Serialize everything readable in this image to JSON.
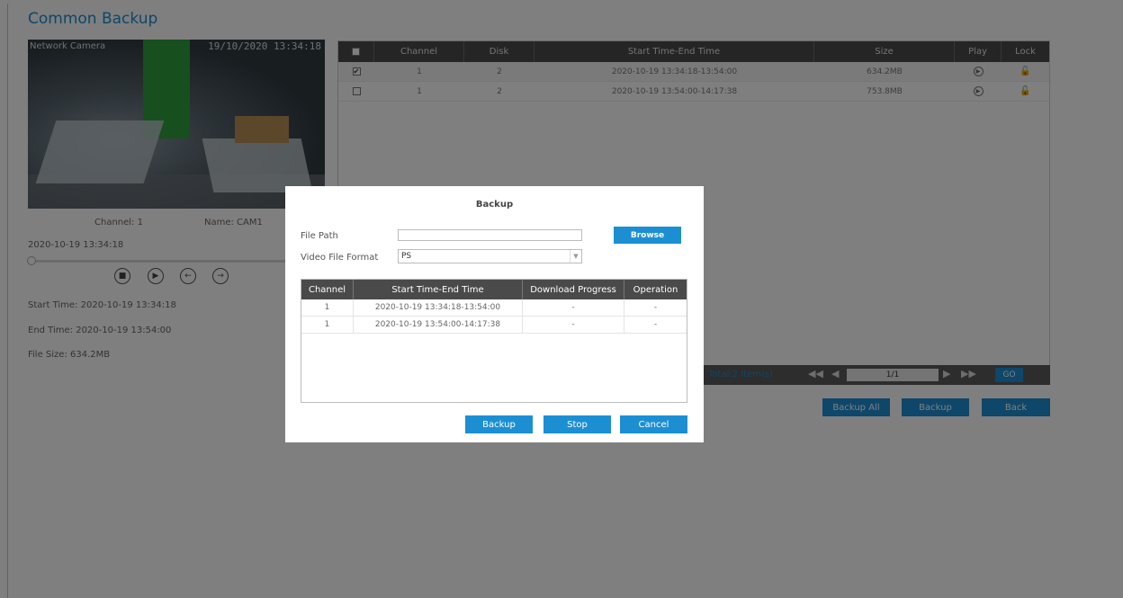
{
  "page": {
    "title": "Common Backup"
  },
  "preview": {
    "overlay_label": "Network Camera",
    "overlay_time": "19/10/2020 13:34:18",
    "channel": "Channel: 1",
    "name": "Name: CAM1",
    "current_time": "2020-10-19 13:34:18",
    "controls": {
      "stop_icon": "stop-icon",
      "play_icon": "play-icon",
      "back_icon": "step-back-icon",
      "forward_icon": "step-forward-icon"
    },
    "start_time": "Start Time: 2020-10-19 13:34:18",
    "end_time": "End Time: 2020-10-19 13:54:00",
    "file_size": "File Size: 634.2MB"
  },
  "file_table": {
    "headers": {
      "select": "",
      "channel": "Channel",
      "disk": "Disk",
      "time": "Start Time-End Time",
      "size": "Size",
      "play": "Play",
      "lock": "Lock"
    },
    "rows": [
      {
        "checked": "✔",
        "channel": "1",
        "disk": "2",
        "time": "2020-10-19 13:34:18-13:54:00",
        "size": "634.2MB"
      },
      {
        "checked": "",
        "channel": "1",
        "disk": "2",
        "time": "2020-10-19 13:54:00-14:17:38",
        "size": "753.8MB"
      }
    ]
  },
  "pager": {
    "total": "Total:2 Item(s)",
    "page": "1/1",
    "go": "GO"
  },
  "page_buttons": {
    "backup_all": "Backup All",
    "backup": "Backup",
    "back": "Back"
  },
  "dialog": {
    "title": "Backup",
    "file_path_label": "File Path",
    "file_path_value": "",
    "browse": "Browse",
    "format_label": "Video File Format",
    "format_value": "PS",
    "table": {
      "headers": {
        "channel": "Channel",
        "time": "Start Time-End Time",
        "progress": "Download Progress",
        "operation": "Operation"
      },
      "rows": [
        {
          "channel": "1",
          "time": "2020-10-19 13:34:18-13:54:00",
          "progress": "-",
          "operation": "-"
        },
        {
          "channel": "1",
          "time": "2020-10-19 13:54:00-14:17:38",
          "progress": "-",
          "operation": "-"
        }
      ]
    },
    "buttons": {
      "backup": "Backup",
      "stop": "Stop",
      "cancel": "Cancel"
    }
  },
  "colors": {
    "accent": "#1c8fd3",
    "header": "#4a4a4a",
    "title": "#1a8fce"
  }
}
